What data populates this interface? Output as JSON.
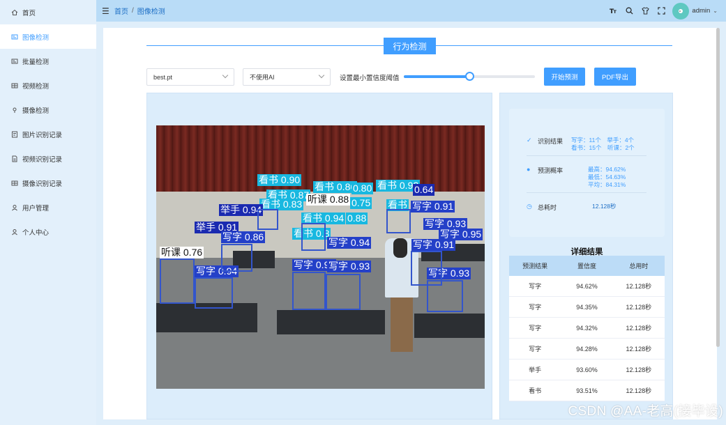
{
  "sidebar": {
    "items": [
      {
        "label": "首页",
        "icon": "home-icon"
      },
      {
        "label": "图像检测",
        "icon": "image-icon",
        "active": true
      },
      {
        "label": "批量检测",
        "icon": "batch-icon"
      },
      {
        "label": "视频检测",
        "icon": "video-icon"
      },
      {
        "label": "摄像检测",
        "icon": "camera-icon"
      },
      {
        "label": "图片识别记录",
        "icon": "image-record-icon"
      },
      {
        "label": "视频识别记录",
        "icon": "video-record-icon"
      },
      {
        "label": "摄像识别记录",
        "icon": "camera-record-icon"
      },
      {
        "label": "用户管理",
        "icon": "user-manage-icon"
      },
      {
        "label": "个人中心",
        "icon": "person-icon"
      }
    ]
  },
  "header": {
    "breadcrumb_home": "首页",
    "breadcrumb_sep": "/",
    "breadcrumb_current": "图像检测",
    "user_name": "admin"
  },
  "page": {
    "title": "行为检测",
    "model_select": "best.pt",
    "ai_select": "不使用AI",
    "slider_label": "设置最小置信度阈值",
    "slider_value": 0.5,
    "start_button": "开始预测",
    "pdf_button": "PDF导出"
  },
  "image": {
    "labels": [
      {
        "text": "看书 0.90",
        "cls": "k"
      },
      {
        "text": "看书 0.86",
        "cls": "k"
      },
      {
        "text": "看书 0.92",
        "cls": "k"
      },
      {
        "text": "0.80",
        "cls": "k"
      },
      {
        "text": "0.64",
        "cls": "j"
      },
      {
        "text": "看书 0.87",
        "cls": "k"
      },
      {
        "text": "看书 0.83",
        "cls": "k"
      },
      {
        "text": "听课 0.88",
        "cls": "t"
      },
      {
        "text": "0.75",
        "cls": "k"
      },
      {
        "text": "看书",
        "cls": "k"
      },
      {
        "text": "写字 0.91",
        "cls": "w"
      },
      {
        "text": "举手 0.94",
        "cls": "j"
      },
      {
        "text": "看书 0.94",
        "cls": "k"
      },
      {
        "text": "0.88",
        "cls": "k"
      },
      {
        "text": "写字 0.93",
        "cls": "w"
      },
      {
        "text": "举手 0.91",
        "cls": "j"
      },
      {
        "text": "写字 0.86",
        "cls": "w"
      },
      {
        "text": "看书 0.8",
        "cls": "k"
      },
      {
        "text": "写字 0.95",
        "cls": "w"
      },
      {
        "text": "写字 0.94",
        "cls": "w"
      },
      {
        "text": "写字 0.91",
        "cls": "w"
      },
      {
        "text": "听课 0.76",
        "cls": "t"
      },
      {
        "text": "写字 0.94",
        "cls": "w"
      },
      {
        "text": "写字 0.94",
        "cls": "w"
      },
      {
        "text": "写字 0.93",
        "cls": "w"
      },
      {
        "text": "写字 0.93",
        "cls": "w"
      }
    ]
  },
  "stats": {
    "result_label": "识别结果",
    "result_line1": "写字：11个　举手：4个",
    "result_line2": "看书：15个　听课：2个",
    "prob_label": "预测概率",
    "prob_max": "最高：94.62%",
    "prob_min": "最低：54.63%",
    "prob_avg": "平均：84.31%",
    "time_label": "总耗时",
    "time_value": "12.128秒"
  },
  "detail": {
    "title": "详细结果",
    "columns": [
      "预测结果",
      "置信度",
      "总用时"
    ],
    "rows": [
      [
        "写字",
        "94.62%",
        "12.128秒"
      ],
      [
        "写字",
        "94.35%",
        "12.128秒"
      ],
      [
        "写字",
        "94.32%",
        "12.128秒"
      ],
      [
        "写字",
        "94.28%",
        "12.128秒"
      ],
      [
        "举手",
        "93.60%",
        "12.128秒"
      ],
      [
        "看书",
        "93.51%",
        "12.128秒"
      ]
    ]
  },
  "watermark": "CSDN @AA-老高(接毕设)"
}
